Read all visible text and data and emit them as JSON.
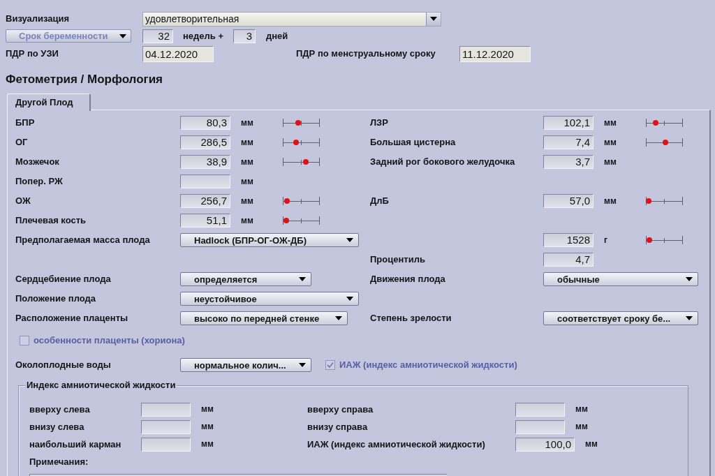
{
  "visualization": {
    "label": "Визуализация",
    "value": "удовлетворительная"
  },
  "gestational_age": {
    "button": {
      "label": "Срок беременности",
      "disabled": true
    },
    "weeks": "32",
    "weeks_label": "недель +",
    "days": "3",
    "days_label": "дней"
  },
  "due_dates": [
    {
      "label": "ПДР по УЗИ",
      "value": "04.12.2020"
    },
    {
      "label": "ПДР по менструальному сроку",
      "value": "11.12.2020"
    }
  ],
  "section_title": "Фетометрия / Морфология",
  "tabs": [
    {
      "label": "Другой Плод",
      "selected": true
    }
  ],
  "form_rows": [
    {
      "left": {
        "kind": "measure",
        "label": "БПР",
        "value": "80,3",
        "unit": "мм",
        "level": 0.42
      },
      "right": {
        "kind": "measure",
        "label": "ЛЗР",
        "value": "102,1",
        "unit": "мм",
        "level": 0.26
      }
    },
    {
      "left": {
        "kind": "measure",
        "label": "ОГ",
        "value": "286,5",
        "unit": "мм",
        "level": 0.36
      },
      "right": {
        "kind": "measure",
        "label": "Большая цистерна",
        "value": "7,4",
        "unit": "мм",
        "level": 0.53
      }
    },
    {
      "left": {
        "kind": "measure",
        "label": "Мозжечок",
        "value": "38,9",
        "unit": "мм",
        "level": 0.62
      },
      "right": {
        "kind": "measure",
        "label": "Задний рог бокового желудочка",
        "value": "3,7",
        "unit": "мм"
      }
    },
    {
      "left": {
        "kind": "measure",
        "label": "Попер. РЖ",
        "unit": "мм"
      }
    },
    {
      "left": {
        "kind": "measure",
        "label": "ОЖ",
        "value": "256,7",
        "unit": "мм",
        "level": 0.11
      },
      "right": {
        "kind": "measure",
        "label": "ДлБ",
        "value": "57,0",
        "unit": "мм",
        "level": 0.08
      }
    },
    {
      "left": {
        "kind": "measure",
        "label": "Плечевая кость",
        "value": "51,1",
        "unit": "мм",
        "level": 0.09
      }
    },
    {
      "left": {
        "kind": "select",
        "label": "Предполагаемая масса плода",
        "value": "Hadlock (БПР-ОГ-ОЖ-ДБ)"
      },
      "right": {
        "kind": "measure",
        "value": "1528",
        "unit": "г",
        "level": 0.09
      }
    },
    {
      "right": {
        "kind": "measure",
        "label": "Процентиль",
        "value": "4,7"
      }
    },
    {
      "left": {
        "kind": "select",
        "label": "Сердцебиение плода",
        "value": "определяется"
      },
      "right": {
        "kind": "select",
        "label": "Движения плода",
        "value": "обычные"
      }
    },
    {
      "left": {
        "kind": "select",
        "label": "Положение плода",
        "value": "неустойчивое"
      }
    },
    {
      "left": {
        "kind": "select",
        "label": "Расположение плаценты",
        "value": "высоко по передней стенке"
      },
      "right": {
        "kind": "select",
        "label": "Степень зрелости",
        "value": "соответствует сроку бе..."
      }
    },
    {
      "checkbox": {
        "label": "особенности плаценты (хориона)",
        "checked": false,
        "disabled": true
      }
    },
    {
      "left": {
        "kind": "select",
        "label": "Околоплодные воды",
        "value": "нормальное колич..."
      },
      "checkbox": {
        "label": "ИАЖ (индекс амниотической жидкости)",
        "checked": true,
        "disabled": true
      }
    }
  ],
  "amniotic_index": {
    "title": "Индекс амниотической жидкости",
    "rows": [
      {
        "left": {
          "label": "вверху слева",
          "unit": "мм"
        },
        "right": {
          "label": "вверху справа",
          "unit": "мм"
        }
      },
      {
        "left": {
          "label": "внизу слева",
          "unit": "мм"
        },
        "right": {
          "label": "внизу справа",
          "unit": "мм"
        }
      },
      {
        "left": {
          "label": "наибольший карман",
          "unit": "мм"
        },
        "right": {
          "label": "ИАЖ (индекс амниотической жидкости)",
          "value": "100,0",
          "unit": "мм"
        }
      }
    ],
    "notes_label": "Примечания:"
  }
}
